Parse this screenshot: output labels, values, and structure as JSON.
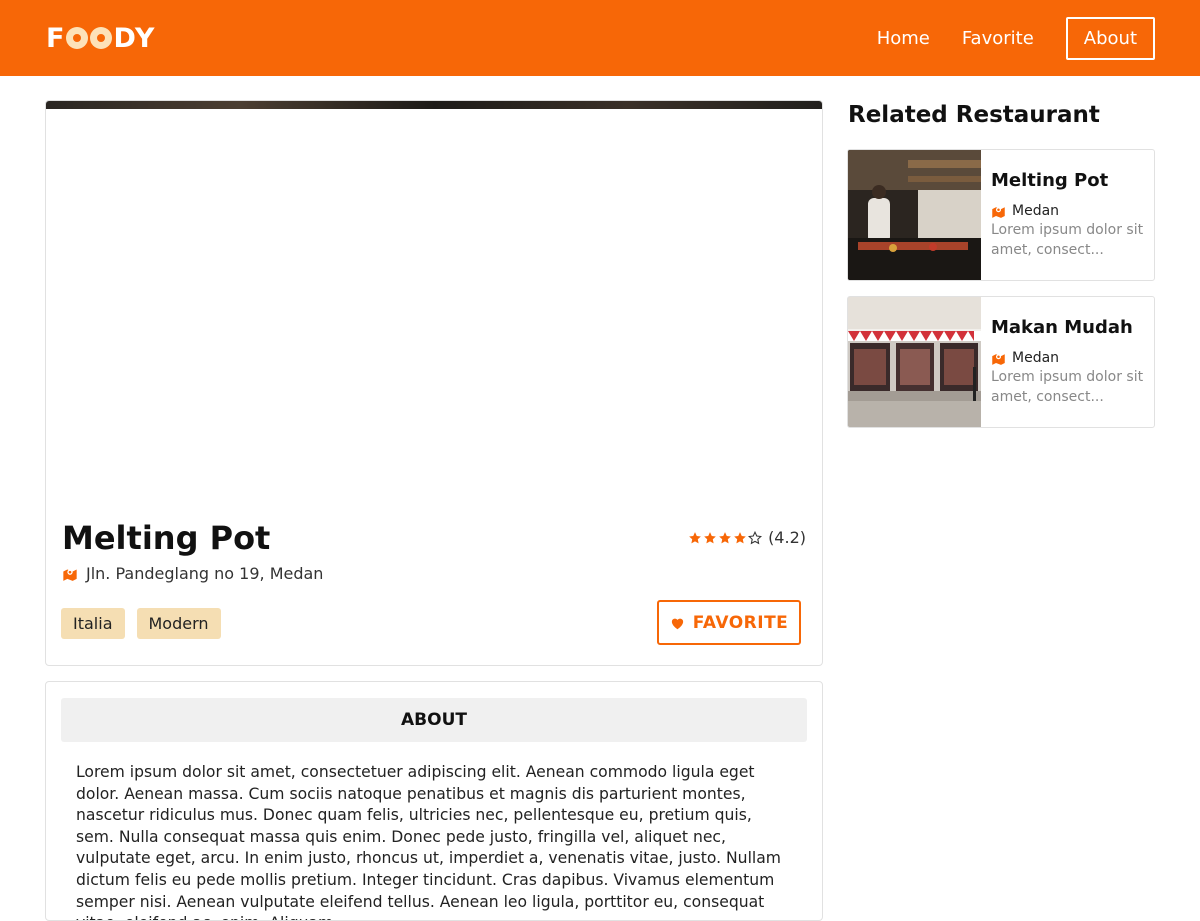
{
  "header": {
    "logo_prefix": "F",
    "logo_suffix": "DY",
    "nav": [
      {
        "label": "Home"
      },
      {
        "label": "Favorite"
      },
      {
        "label": "About"
      }
    ]
  },
  "restaurant": {
    "name": "Melting Pot",
    "rating_text": "(4.2)",
    "rating_value": 4.2,
    "address": "Jln. Pandeglang no 19, Medan",
    "tags": [
      "Italia",
      "Modern"
    ],
    "favorite_label": "FAVORITE"
  },
  "about": {
    "heading": "ABOUT",
    "text": "Lorem ipsum dolor sit amet, consectetuer adipiscing elit. Aenean commodo ligula eget dolor. Aenean massa. Cum sociis natoque penatibus et magnis dis parturient montes, nascetur ridiculus mus. Donec quam felis, ultricies nec, pellentesque eu, pretium quis, sem. Nulla consequat massa quis enim. Donec pede justo, fringilla vel, aliquet nec, vulputate eget, arcu. In enim justo, rhoncus ut, imperdiet a, venenatis vitae, justo. Nullam dictum felis eu pede mollis pretium. Integer tincidunt. Cras dapibus. Vivamus elementum semper nisi. Aenean vulputate eleifend tellus. Aenean leo ligula, porttitor eu, consequat vitae, eleifend ac, enim. Aliquam"
  },
  "related": {
    "title": "Related Restaurant",
    "items": [
      {
        "name": "Melting Pot",
        "city": "Medan",
        "desc": "Lorem ipsum dolor sit amet, consect..."
      },
      {
        "name": "Makan Mudah",
        "city": "Medan",
        "desc": "Lorem ipsum dolor sit amet, consect..."
      }
    ]
  },
  "colors": {
    "brand": "#f76707",
    "tag_bg": "#f5deb3"
  },
  "icons": {
    "location": "map-marker-icon",
    "favorite": "heart-icon",
    "star": "star-icon"
  }
}
